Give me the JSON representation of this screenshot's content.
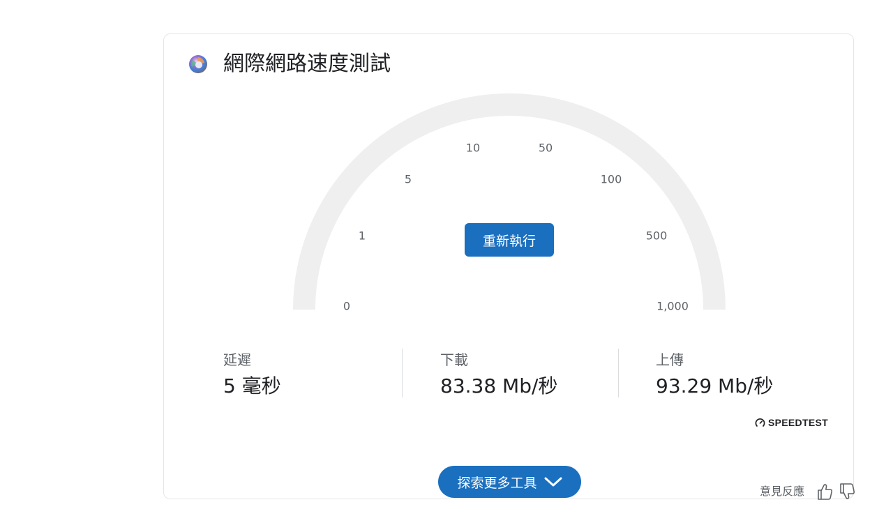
{
  "header": {
    "title": "網際網路速度測試",
    "logo_icon": "speed-test-globe-icon"
  },
  "gauge": {
    "ticks": [
      "0",
      "1",
      "5",
      "10",
      "50",
      "100",
      "500",
      "1,000"
    ],
    "track_color": "#efefef",
    "rerun_label": "重新執行"
  },
  "stats": [
    {
      "label": "延遲",
      "value": "5 毫秒"
    },
    {
      "label": "下載",
      "value": "83.38 Mb/秒"
    },
    {
      "label": "上傳",
      "value": "93.29 Mb/秒"
    }
  ],
  "branding": {
    "speedtest_label": "SPEEDTEST",
    "speedtest_icon": "speedometer-icon"
  },
  "footer": {
    "explore_label": "探索更多工具",
    "explore_icon": "chevron-down-icon",
    "feedback_label": "意見反應",
    "thumb_up_icon": "thumbs-up-icon",
    "thumb_down_icon": "thumbs-down-icon"
  },
  "colors": {
    "accent": "#1a6fbf",
    "text_primary": "#202124",
    "text_secondary": "#5f6368"
  }
}
